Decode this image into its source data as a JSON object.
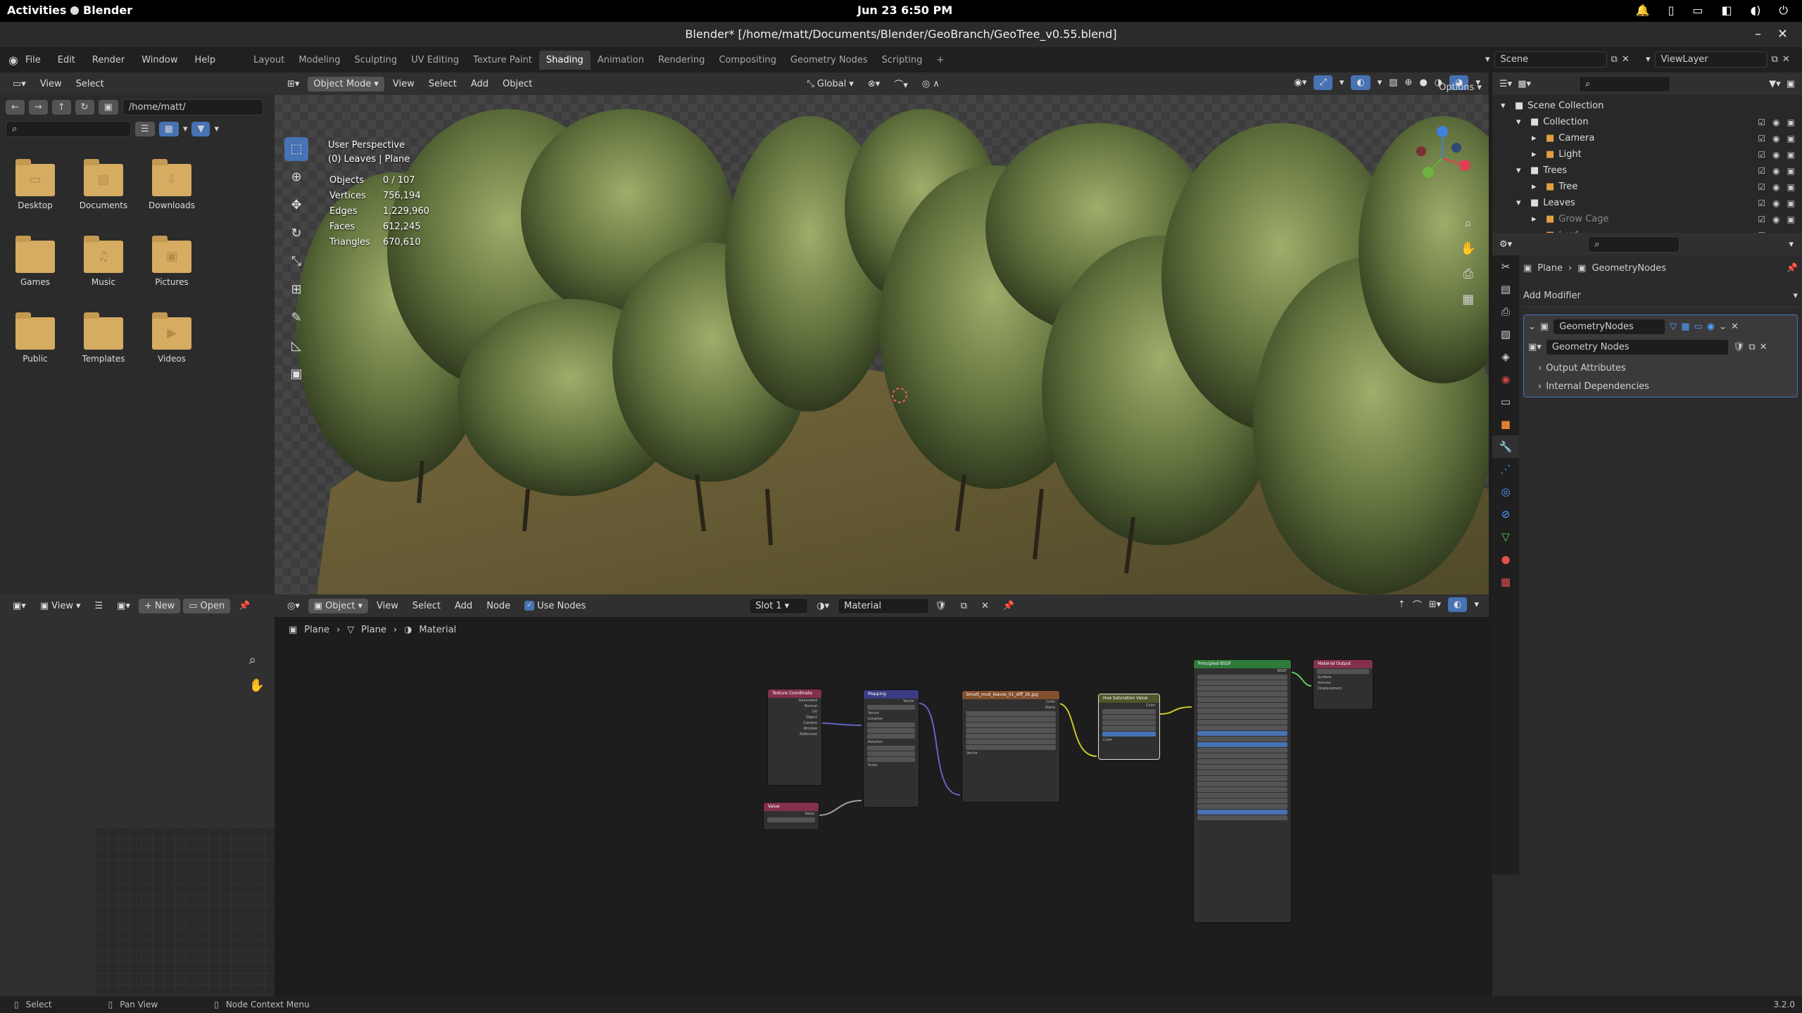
{
  "system": {
    "activities": "Activities",
    "app_name": "Blender",
    "clock": "Jun 23   6:50 PM"
  },
  "window": {
    "title": "Blender* [/home/matt/Documents/Blender/GeoBranch/GeoTree_v0.55.blend]"
  },
  "menubar": {
    "menus": [
      "File",
      "Edit",
      "Render",
      "Window",
      "Help"
    ],
    "workspaces": [
      "Layout",
      "Modeling",
      "Sculpting",
      "UV Editing",
      "Texture Paint",
      "Shading",
      "Animation",
      "Rendering",
      "Compositing",
      "Geometry Nodes",
      "Scripting"
    ],
    "active_workspace": "Shading",
    "scene_label": "Scene",
    "viewlayer_label": "ViewLayer"
  },
  "filebrowser": {
    "menus": [
      "View",
      "Select"
    ],
    "path": "/home/matt/",
    "search_placeholder": "",
    "items": [
      {
        "name": "Desktop",
        "icon": "desktop-icon",
        "glyph": "▭"
      },
      {
        "name": "Documents",
        "icon": "documents-icon",
        "glyph": "▤"
      },
      {
        "name": "Downloads",
        "icon": "downloads-icon",
        "glyph": "⇩"
      },
      {
        "name": "Games",
        "icon": "games-icon",
        "glyph": ""
      },
      {
        "name": "Music",
        "icon": "music-icon",
        "glyph": "♫"
      },
      {
        "name": "Pictures",
        "icon": "pictures-icon",
        "glyph": "▣"
      },
      {
        "name": "Public",
        "icon": "public-icon",
        "glyph": ""
      },
      {
        "name": "Templates",
        "icon": "templates-icon",
        "glyph": ""
      },
      {
        "name": "Videos",
        "icon": "videos-icon",
        "glyph": "▶"
      }
    ]
  },
  "viewport": {
    "mode": "Object Mode",
    "menus": [
      "View",
      "Select",
      "Add",
      "Object"
    ],
    "orientation": "Global",
    "options_label": "Options",
    "perspective": "User Perspective",
    "context": "(0) Leaves | Plane",
    "stats": [
      {
        "label": "Objects",
        "value": "0 / 107"
      },
      {
        "label": "Vertices",
        "value": "756,194"
      },
      {
        "label": "Edges",
        "value": "1,229,960"
      },
      {
        "label": "Faces",
        "value": "612,245"
      },
      {
        "label": "Triangles",
        "value": "670,610"
      }
    ]
  },
  "outliner": {
    "rows": [
      {
        "label": "Scene Collection",
        "indent": 0,
        "icon": "scene-collection-icon"
      },
      {
        "label": "Collection",
        "indent": 1,
        "icon": "collection-icon"
      },
      {
        "label": "Camera",
        "indent": 2,
        "icon": "camera-icon"
      },
      {
        "label": "Light",
        "indent": 2,
        "icon": "light-icon"
      },
      {
        "label": "Trees",
        "indent": 1,
        "icon": "collection-icon"
      },
      {
        "label": "Tree",
        "indent": 2,
        "icon": "curve-icon"
      },
      {
        "label": "Leaves",
        "indent": 1,
        "icon": "collection-icon"
      },
      {
        "label": "Grow Cage",
        "indent": 2,
        "icon": "mesh-icon"
      },
      {
        "label": "Leaf",
        "indent": 2,
        "icon": "mesh-icon"
      }
    ]
  },
  "properties": {
    "breadcrumb_object": "Plane",
    "breadcrumb_modifier": "GeometryNodes",
    "add_modifier": "Add Modifier",
    "modifier_name": "GeometryNodes",
    "node_group": "Geometry Nodes",
    "panels": [
      "Output Attributes",
      "Internal Dependencies"
    ]
  },
  "image_editor": {
    "view_label": "View",
    "new_label": "New",
    "open_label": "Open"
  },
  "node_editor": {
    "type": "Object",
    "menus": [
      "View",
      "Select",
      "Add",
      "Node"
    ],
    "use_nodes": "Use Nodes",
    "slot": "Slot 1",
    "material": "Material",
    "breadcrumbs": [
      "Plane",
      "Plane",
      "Material"
    ],
    "nodes": {
      "texcoord": "Texture Coordinate",
      "mapping": "Mapping",
      "image": "bmatt_mud_leaves_01_diff_2k.jpg",
      "huesat": "Hue Saturation Value",
      "bsdf": "Principled BSDF",
      "output": "Material Output",
      "value": "Value"
    }
  },
  "statusbar": {
    "select": "Select",
    "pan": "Pan View",
    "context": "Node Context Menu",
    "version": "3.2.0"
  }
}
